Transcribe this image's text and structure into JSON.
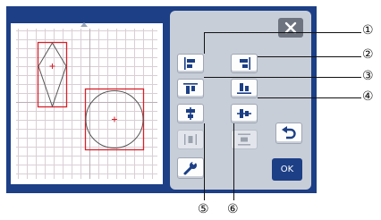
{
  "panel": {
    "ok_label": "OK",
    "icons": {
      "close": "close-icon",
      "undo": "undo-icon",
      "settings": "wrench-icon"
    }
  },
  "callouts": [
    "①",
    "②",
    "③",
    "④",
    "⑤",
    "⑥"
  ],
  "colors": {
    "screen_frame": "#1c3f86",
    "panel_bg": "#c8ced8",
    "shape_outline": "#d8202a",
    "ok_button": "#1c3f86"
  }
}
